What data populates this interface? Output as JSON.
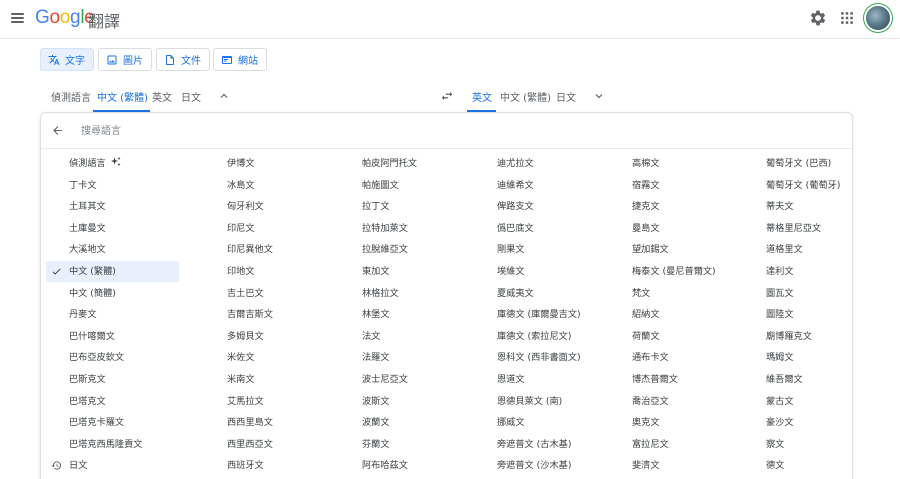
{
  "app": {
    "title": "翻譯",
    "logo": "Google"
  },
  "modes": [
    {
      "label": "文字",
      "icon": "translate-icon",
      "active": true
    },
    {
      "label": "圖片",
      "icon": "image-icon",
      "active": false
    },
    {
      "label": "文件",
      "icon": "document-icon",
      "active": false
    },
    {
      "label": "網站",
      "icon": "website-icon",
      "active": false
    }
  ],
  "source_tabs": [
    "偵測語言",
    "中文 (繁體)",
    "英文",
    "日文"
  ],
  "target_tabs": [
    "英文",
    "中文 (繁體)",
    "日文"
  ],
  "search": {
    "placeholder": "搜尋語言"
  },
  "selected_language": "中文 (繁體)",
  "columns": [
    [
      "偵測語言",
      "丁卡文",
      "土耳其文",
      "土庫曼文",
      "大溪地文",
      "中文 (繁體)",
      "中文 (簡體)",
      "丹麥文",
      "巴什喀爾文",
      "巴布亞皮欽文",
      "巴斯克文",
      "巴塔克文",
      "巴塔克卡羅文",
      "巴塔克西馬隆貢文",
      "日文"
    ],
    [
      "伊博文",
      "冰島文",
      "匈牙利文",
      "印尼文",
      "印尼異他文",
      "印地文",
      "吉土巴文",
      "吉爾吉斯文",
      "多姆貝文",
      "米佐文",
      "米南文",
      "艾馬拉文",
      "西西里島文",
      "西里西亞文",
      "西班牙文"
    ],
    [
      "帕皮阿門托文",
      "帕施圖文",
      "拉丁文",
      "拉特加萊文",
      "拉脫維亞文",
      "東加文",
      "林格拉文",
      "林堡文",
      "法文",
      "法羅文",
      "波士尼亞文",
      "波斯文",
      "波蘭文",
      "芬蘭文",
      "阿布哈茲文"
    ],
    [
      "迪尤拉文",
      "迪維希文",
      "俾路支文",
      "僞巴底文",
      "剛果文",
      "埃維文",
      "夏威夷文",
      "庫德文 (庫爾曼吉文)",
      "庫德文 (索拉尼文)",
      "恩科文 (西非書面文)",
      "恩道文",
      "恩德貝萊文 (南)",
      "挪威文",
      "旁遮普文 (古木基)",
      "旁遮普文 (沙木基)"
    ],
    [
      "高棉文",
      "宿霧文",
      "捷克文",
      "曼島文",
      "望加錫文",
      "梅泰文 (曼尼普爾文)",
      "梵文",
      "紹納文",
      "荷蘭文",
      "通布卡文",
      "博杰普爾文",
      "喬治亞文",
      "奧克文",
      "富拉尼文",
      "斐濟文"
    ],
    [
      "葡萄牙文 (巴西)",
      "葡萄牙文 (葡萄牙)",
      "蒂夫文",
      "蒂格里尼亞文",
      "道格里文",
      "達利文",
      "圖瓦文",
      "圖陸文",
      "廟博羅克文",
      "瑪姆文",
      "維吾爾文",
      "蒙古文",
      "豪沙文",
      "察文",
      "德文"
    ]
  ],
  "icons": {
    "menu": "menu-icon",
    "settings": "gear-icon",
    "apps": "apps-grid-icon",
    "swap": "swap-icon",
    "back": "arrow-left-icon",
    "check": "check-icon",
    "history": "history-icon",
    "sparkle": "sparkle-icon"
  },
  "colors": {
    "accent": "#1a73e8",
    "selected_bg": "#e8f0fe",
    "text": "#3c4043",
    "muted": "#5f6368"
  }
}
